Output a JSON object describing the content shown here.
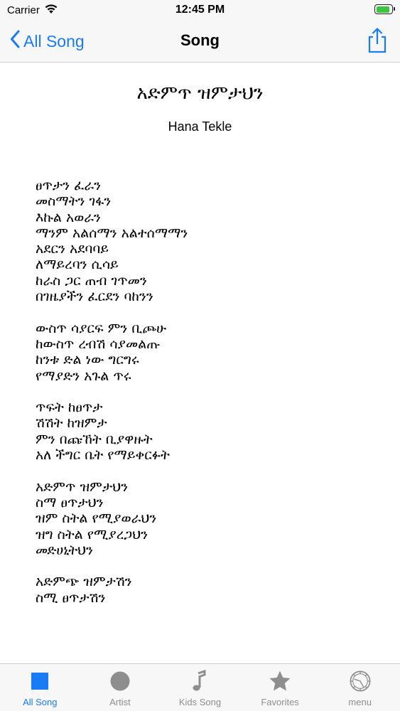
{
  "status_bar": {
    "carrier": "Carrier",
    "time": "12:45 PM"
  },
  "nav": {
    "back_label": "All Song",
    "title": "Song",
    "share_icon": "share-icon"
  },
  "song": {
    "title": "አድምጥ ዝምታህን",
    "artist": "Hana Tekle",
    "stanzas": [
      [
        "ፀጥታን ፈራን",
        "መስማትን ገፋን",
        "እኩል አወራን",
        "ማንም አልሰማን አልተሰማማን",
        "አደርን አደባባይ",
        "ለማይረባን ሲሳይ",
        "ከራስ ጋር ጠብ ገጥመን",
        "በገዜያችን ፈርደን ባከንን"
      ],
      [
        "ውስጥ ሳያርፍ ምን ቢጮሁ",
        "ከውስጥ ረብሽ ሳያመልጡ",
        "ከንቱ ድል ነው ግርግሩ",
        "የማያድን አጉል ጥሩ"
      ],
      [
        "ጥፍት ከፀጥታ",
        "ሽሽት ከዝምታ",
        "ምን በጩኸት ቢያዋዙት",
        "አለ ችግር ቤት የማይቀርፉት"
      ],
      [
        "አድምጥ ዝምታህን",
        "ስማ ፀጥታህን",
        "ዝም ስትል የሚያወራህን",
        "ዝግ ስትል የሚያረጋህን",
        "መድሀኒትህን"
      ],
      [
        "አድምጭ ዝምታሽን",
        "ስሚ ፀጥታሽን"
      ]
    ]
  },
  "tabs": [
    {
      "label": "All Song",
      "icon": "square-icon",
      "active": true
    },
    {
      "label": "Artist",
      "icon": "circle-icon",
      "active": false
    },
    {
      "label": "Kids Song",
      "icon": "music-note-icon",
      "active": false
    },
    {
      "label": "Favorites",
      "icon": "star-icon",
      "active": false
    },
    {
      "label": "menu",
      "icon": "gear-icon",
      "active": false
    }
  ],
  "colors": {
    "accent": "#1a7cf4",
    "inactive": "#8e8e8e",
    "bar_background": "#f7f7f7",
    "battery_fill": "#3ec43e"
  }
}
